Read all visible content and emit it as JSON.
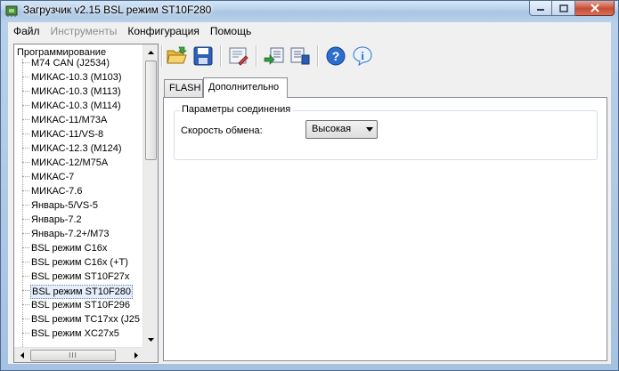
{
  "window": {
    "title": "Загрузчик v2.15 BSL режим ST10F280"
  },
  "menu": [
    "Файл",
    "Инструменты",
    "Конфигурация",
    "Помощь"
  ],
  "menu_disabled_index": 1,
  "tree": {
    "root": "Программирование",
    "items": [
      "M74 CAN (J2534)",
      "МИКАС-10.3 (M103)",
      "МИКАС-10.3 (M113)",
      "МИКАС-10.3 (M114)",
      "МИКАС-11/M73A",
      "МИКАС-11/VS-8",
      "МИКАС-12.3 (M124)",
      "МИКАС-12/M75A",
      "МИКАС-7",
      "МИКАС-7.6",
      "Январь-5/VS-5",
      "Январь-7.2",
      "Январь-7.2+/M73",
      "BSL режим C16x",
      "BSL режим C16x (+T)",
      "BSL режим ST10F27x",
      "BSL режим ST10F280",
      "BSL режим ST10F296",
      "BSL режим TC17xx (J25",
      "BSL режим XC27x5"
    ],
    "selected_index": 16
  },
  "toolbar": {
    "buttons": [
      "open-icon",
      "save-icon",
      "settings-icon",
      "read-icon",
      "write-icon",
      "help-icon",
      "info-icon"
    ]
  },
  "tabs": [
    "FLASH",
    "Дополнительно"
  ],
  "active_tab_index": 1,
  "connection": {
    "group_title": "Параметры соединения",
    "speed_label": "Скорость обмена:",
    "speed_value": "Высокая"
  },
  "scrollbar": {
    "h_thumb_grip": "III"
  },
  "colors": {
    "title_gradient": "#b9d1ea",
    "selection": "#e6eefb",
    "close_button": "#c84c33"
  }
}
